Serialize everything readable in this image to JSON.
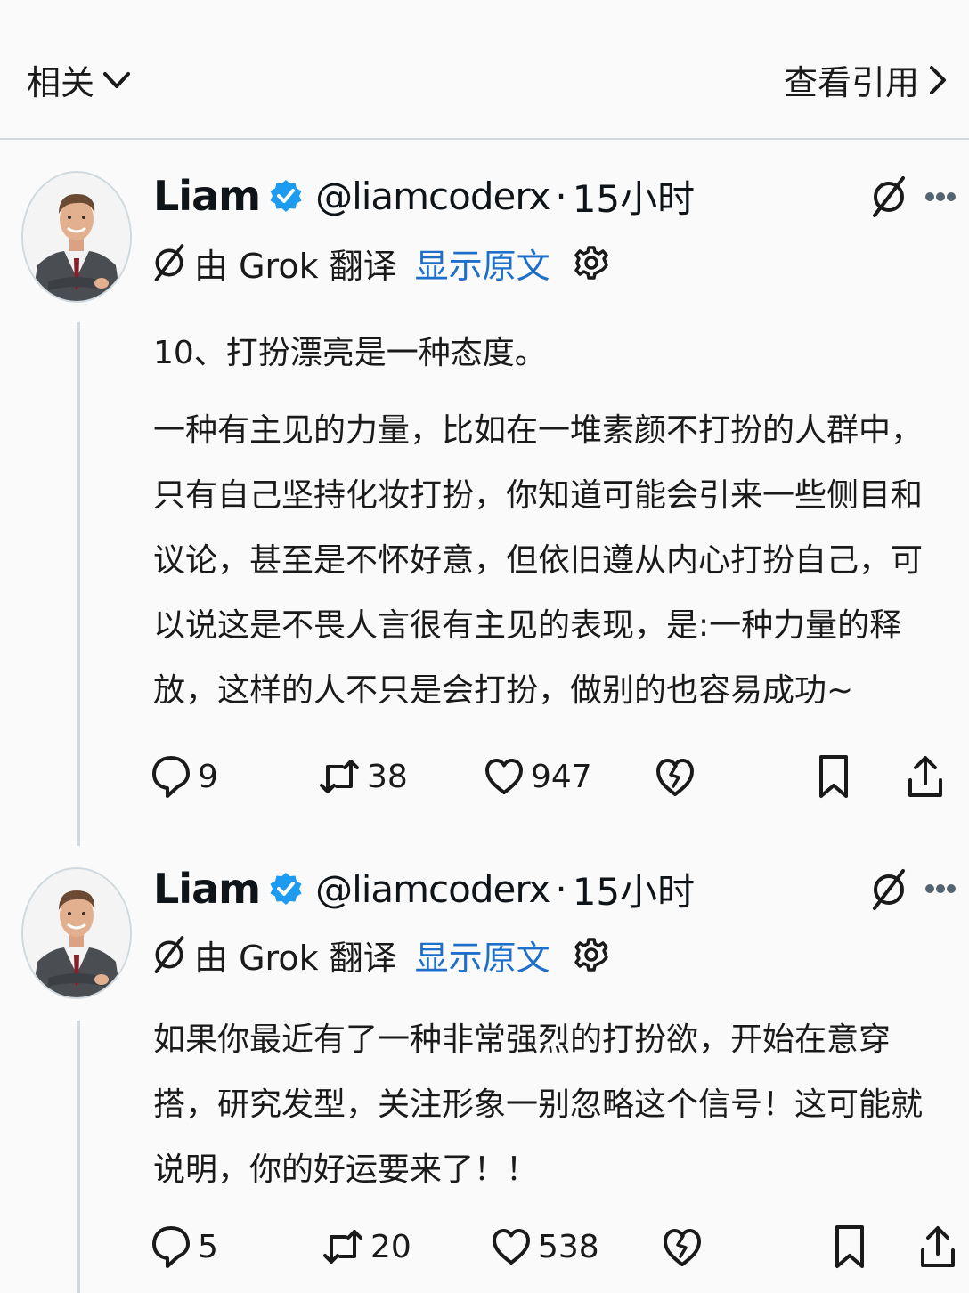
{
  "topbar": {
    "left_label": "相关",
    "right_label": "查看引用"
  },
  "posts": [
    {
      "author": {
        "name": "Liam",
        "handle": "@liamcoderx",
        "time": "15小时"
      },
      "translation": {
        "label": "由 Grok 翻译",
        "show_original": "显示原文"
      },
      "paragraphs": [
        "10、打扮漂亮是一种态度。",
        "一种有主见的力量，比如在一堆素颜不打扮的人群中，只有自己坚持化妆打扮，你知道可能会引来一些侧目和议论，甚至是不怀好意，但依旧遵从内心打扮自己，可以说这是不畏人言很有主见的表现，是:一种力量的释放，这样的人不只是会打扮，做别的也容易成功~"
      ],
      "stats": {
        "replies": "9",
        "reposts": "38",
        "likes": "947"
      }
    },
    {
      "author": {
        "name": "Liam",
        "handle": "@liamcoderx",
        "time": "15小时"
      },
      "translation": {
        "label": "由 Grok 翻译",
        "show_original": "显示原文"
      },
      "paragraphs": [
        "如果你最近有了一种非常强烈的打扮欲，开始在意穿搭，研究发型，关注形象一别忽略这个信号！这可能就说明，你的好运要来了！！"
      ],
      "stats": {
        "replies": "5",
        "reposts": "20",
        "likes": "538"
      }
    }
  ],
  "colors": {
    "link": "#1d6fc9",
    "verified": "#1d9bf0",
    "divider": "#cfd9de",
    "text": "#0f1419"
  }
}
